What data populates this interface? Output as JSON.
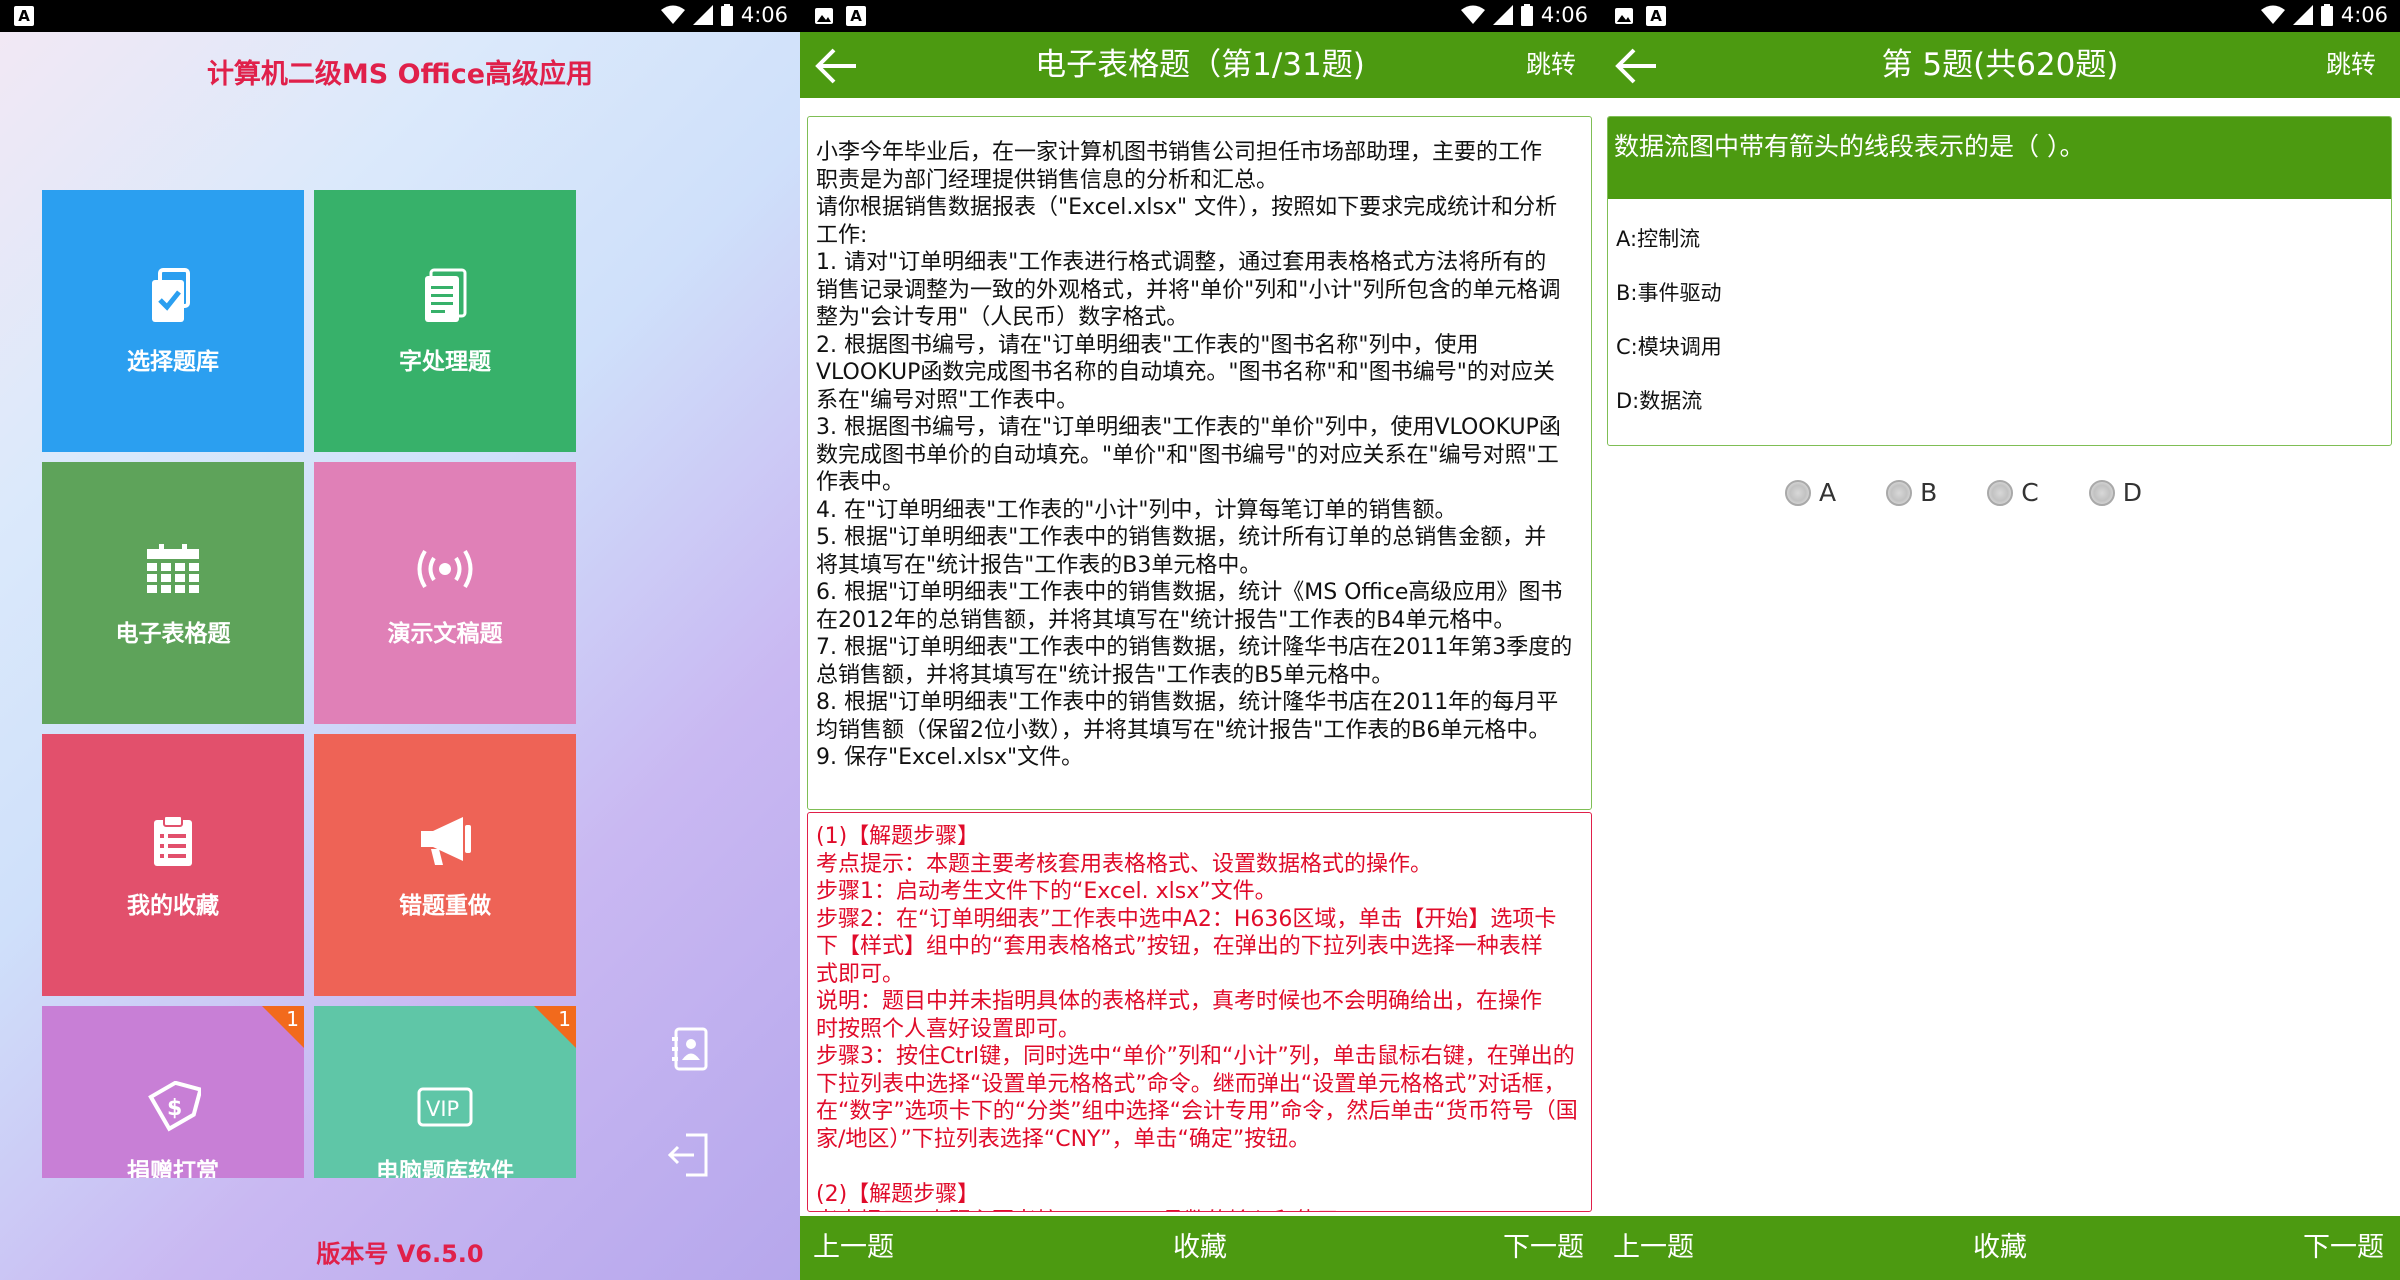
{
  "status_bar": {
    "time": "4:06",
    "badge": "A"
  },
  "home": {
    "app_title": "计算机二级MS Office高级应用",
    "tiles": [
      {
        "label": "选择题库",
        "icon": "clipboard-check-icon",
        "color": "#2b9ff0"
      },
      {
        "label": "字处理题",
        "icon": "document-lines-icon",
        "color": "#37b16a"
      },
      {
        "label": "电子表格题",
        "icon": "calendar-grid-icon",
        "color": "#5ea35a"
      },
      {
        "label": "演示文稿题",
        "icon": "broadcast-icon",
        "color": "#e080b7"
      },
      {
        "label": "我的收藏",
        "icon": "clipboard-list-icon",
        "color": "#e2506c"
      },
      {
        "label": "错题重做",
        "icon": "megaphone-icon",
        "color": "#ee6356"
      },
      {
        "label": "捐赠打赏",
        "icon": "price-tag-icon",
        "color": "#c87fd6",
        "badge": "1"
      },
      {
        "label": "电脑题库软件",
        "icon": "vip-icon",
        "color": "#5fc6a7",
        "badge": "1"
      }
    ],
    "version": "版本号  V6.5.0"
  },
  "spreadsheet": {
    "title": "电子表格题（第1/31题)",
    "jump": "跳转",
    "question_lines": [
      "小李今年毕业后，在一家计算机图书销售公司担任市场部助理，主要的工作",
      "职责是为部门经理提供销售信息的分析和汇总。",
      "请你根据销售数据报表（\"Excel.xlsx\" 文件），按照如下要求完成统计和分析",
      "工作:",
      "1. 请对\"订单明细表\"工作表进行格式调整，通过套用表格格式方法将所有的",
      "销售记录调整为一致的外观格式，并将\"单价\"列和\"小计\"列所包含的单元格调",
      "整为\"会计专用\"（人民币）数字格式。",
      "2. 根据图书编号，请在\"订单明细表\"工作表的\"图书名称\"列中，使用",
      "VLOOKUP函数完成图书名称的自动填充。\"图书名称\"和\"图书编号\"的对应关",
      "系在\"编号对照\"工作表中。",
      "3. 根据图书编号，请在\"订单明细表\"工作表的\"单价\"列中，使用VLOOKUP函",
      "数完成图书单价的自动填充。\"单价\"和\"图书编号\"的对应关系在\"编号对照\"工",
      "作表中。",
      "4. 在\"订单明细表\"工作表的\"小计\"列中，计算每笔订单的销售额。",
      "5. 根据\"订单明细表\"工作表中的销售数据，统计所有订单的总销售金额，并",
      "将其填写在\"统计报告\"工作表的B3单元格中。",
      "6. 根据\"订单明细表\"工作表中的销售数据，统计《MS Office高级应用》图书",
      "在2012年的总销售额，并将其填写在\"统计报告\"工作表的B4单元格中。",
      "7. 根据\"订单明细表\"工作表中的销售数据，统计隆华书店在2011年第3季度的",
      "总销售额，并将其填写在\"统计报告\"工作表的B5单元格中。",
      "8. 根据\"订单明细表\"工作表中的销售数据，统计隆华书店在2011年的每月平",
      "均销售额（保留2位小数），并将其填写在\"统计报告\"工作表的B6单元格中。",
      "9. 保存\"Excel.xlsx\"文件。"
    ],
    "answer_lines": [
      "(1)【解题步骤】",
      "考点提示：本题主要考核套用表格格式、设置数据格式的操作。",
      "步骤1：启动考生文件下的“Excel. xlsx”文件。",
      "步骤2：在“订单明细表”工作表中选中A2：H636区域，单击【开始】选项卡",
      "下【样式】组中的“套用表格格式”按钮，在弹出的下拉列表中选择一种表样",
      "式即可。",
      "说明：题目中并未指明具体的表格样式，真考时候也不会明确给出，在操作",
      "时按照个人喜好设置即可。",
      "步骤3：按住Ctrl键，同时选中“单价”列和“小计”列，单击鼠标右键，在弹出的",
      "下拉列表中选择“设置单元格格式”命令。继而弹出“设置单元格格式”对话框，",
      "在“数字”选项卡下的“分类”组中选择“会计专用”命令，然后单击“货币符号（国",
      "家/地区）”下拉列表选择“CNY”，单击“确定”按钮。",
      "",
      "(2)【解题步骤】",
      "考点提示：本题主要考核VLOOKUP函数的输入和使用。"
    ],
    "prev": "上一题",
    "fav": "收藏",
    "next": "下一题"
  },
  "choice": {
    "title": "第 5题(共620题)",
    "jump": "跳转",
    "question": "数据流图中带有箭头的线段表示的是（ ）。",
    "options": [
      "A:控制流",
      "B:事件驱动",
      "C:模块调用",
      "D:数据流"
    ],
    "radios": [
      "A",
      "B",
      "C",
      "D"
    ],
    "prev": "上一题",
    "fav": "收藏",
    "next": "下一题"
  }
}
